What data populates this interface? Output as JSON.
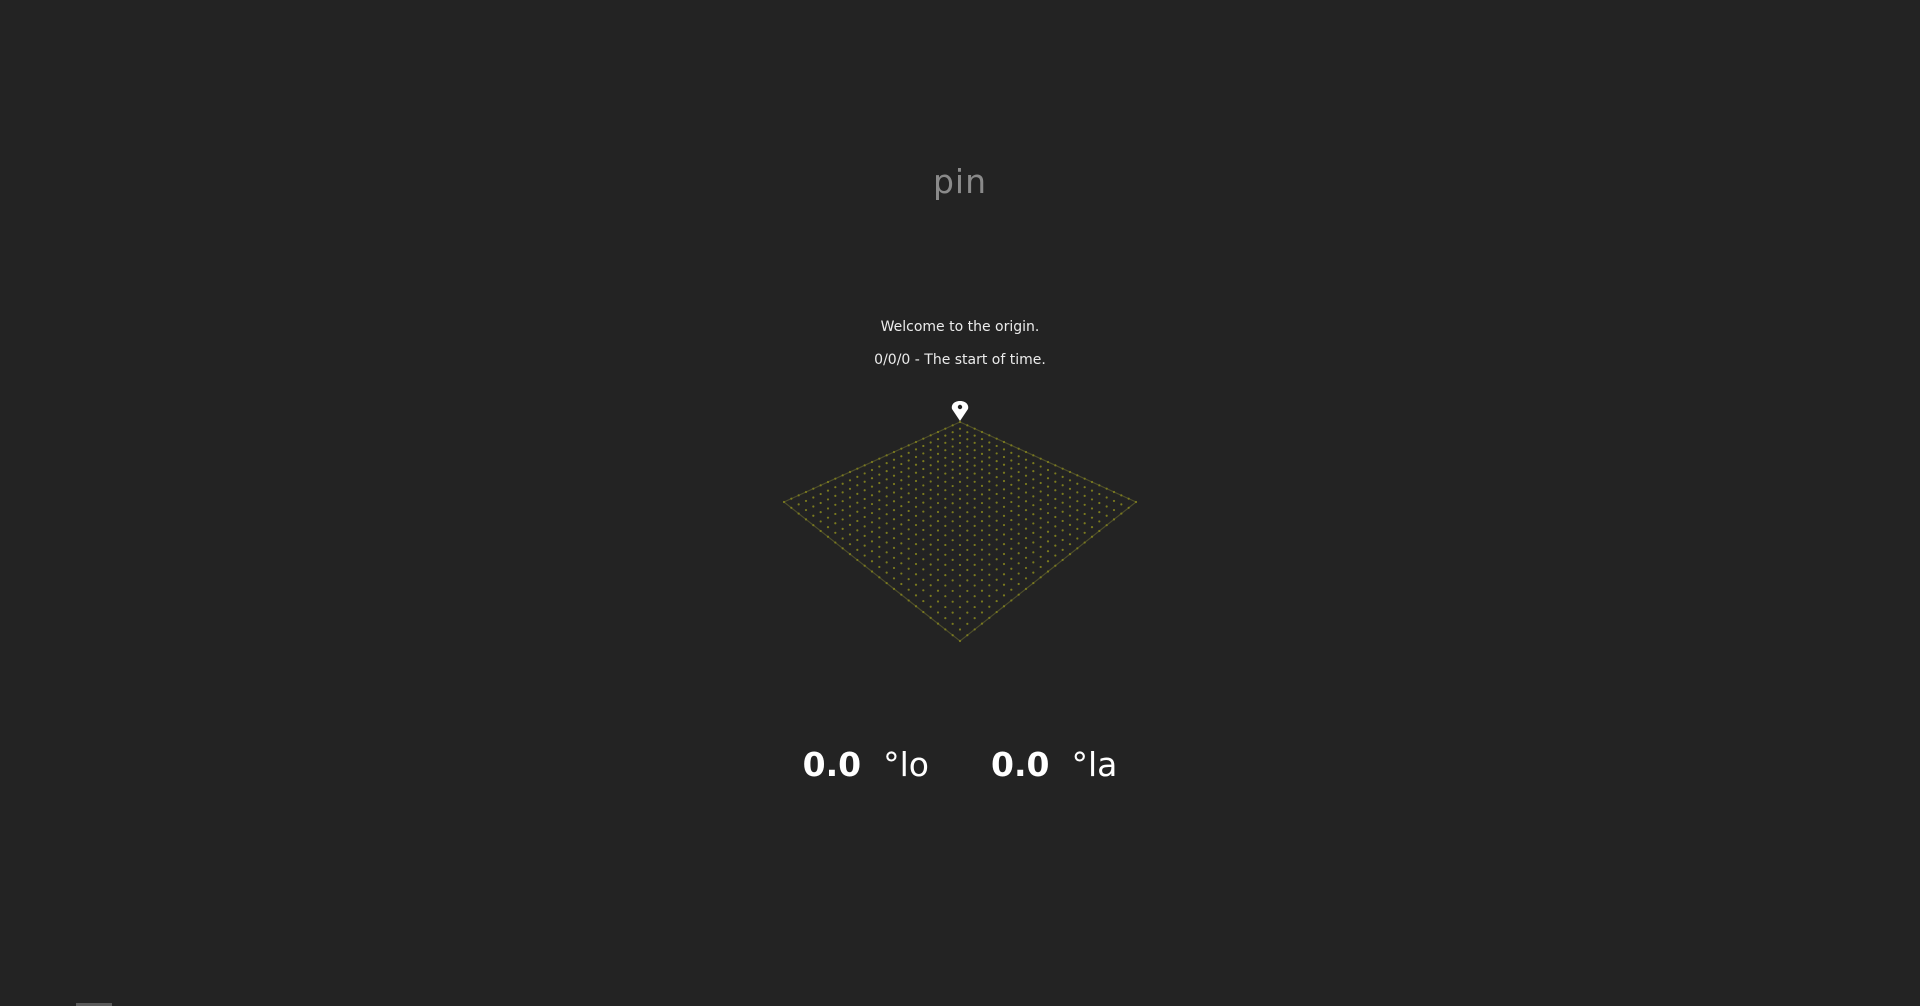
{
  "app": {
    "title": "pin"
  },
  "message": {
    "welcome": "Welcome to the origin.",
    "subtitle": "0/0/0 - The start of time."
  },
  "coordinates": {
    "longitude": {
      "value": "0.0",
      "unit": "°lo"
    },
    "latitude": {
      "value": "0.0",
      "unit": "°la"
    }
  },
  "icons": {
    "pin": "map-pin-icon"
  },
  "colors": {
    "background": "#232323",
    "grid_dot": "#7a7a1e",
    "grid_line": "#4d4d2a",
    "text": "#ececec",
    "title": "#8a8a8a"
  }
}
